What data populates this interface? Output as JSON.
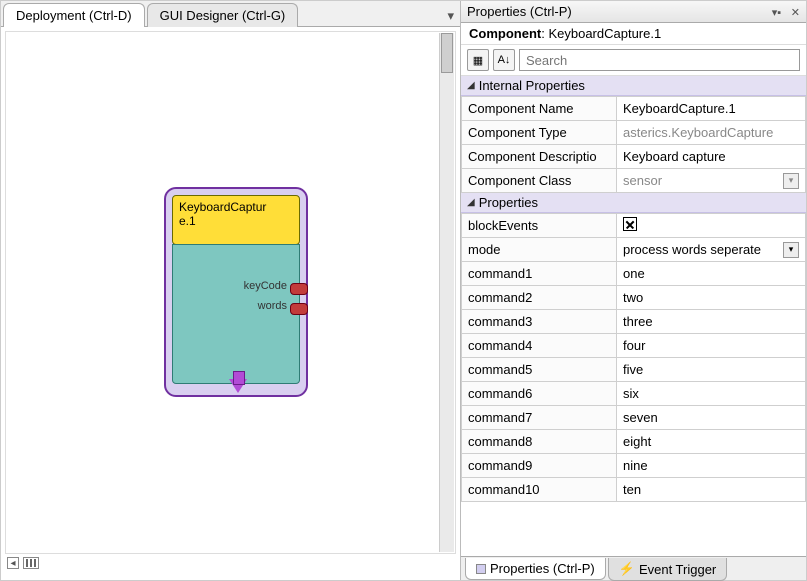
{
  "left": {
    "tabs": {
      "deployment": "Deployment (Ctrl-D)",
      "gui": "GUI Designer (Ctrl-G)"
    },
    "component": {
      "title": "KeyboardCaptur\ne.1",
      "ports": [
        "keyCode",
        "words"
      ]
    }
  },
  "right": {
    "panel_title": "Properties (Ctrl-P)",
    "component_label": "Component",
    "component_name": "KeyboardCapture.1",
    "search": {
      "placeholder": "Search"
    },
    "groups": {
      "internal": "Internal Properties",
      "props": "Properties"
    },
    "internal": [
      {
        "name": "Component Name",
        "value": "KeyboardCapture.1"
      },
      {
        "name": "Component Type",
        "value": "asterics.KeyboardCapture",
        "readonly": true
      },
      {
        "name": "Component Descriptio",
        "value": "Keyboard capture"
      },
      {
        "name": "Component Class",
        "value": "sensor",
        "readonly": true,
        "dropdown": true
      }
    ],
    "props": [
      {
        "name": "blockEvents",
        "value": "checked",
        "checkbox": true
      },
      {
        "name": "mode",
        "value": "process words seperate",
        "dropdown": true
      },
      {
        "name": "command1",
        "value": "one"
      },
      {
        "name": "command2",
        "value": "two"
      },
      {
        "name": "command3",
        "value": "three"
      },
      {
        "name": "command4",
        "value": "four"
      },
      {
        "name": "command5",
        "value": "five"
      },
      {
        "name": "command6",
        "value": "six"
      },
      {
        "name": "command7",
        "value": "seven"
      },
      {
        "name": "command8",
        "value": "eight"
      },
      {
        "name": "command9",
        "value": "nine"
      },
      {
        "name": "command10",
        "value": "ten"
      }
    ],
    "bottom_tabs": {
      "props": "Properties (Ctrl-P)",
      "event": "Event Trigger"
    }
  }
}
